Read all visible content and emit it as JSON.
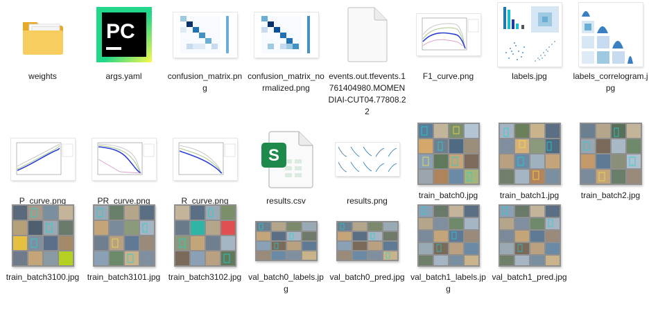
{
  "files": [
    {
      "name": "weights",
      "icon": "folder-icon"
    },
    {
      "name": "args.yaml",
      "icon": "pycharm-icon"
    },
    {
      "name": "confusion_matrix.png",
      "icon": "confusion-matrix-thumbnail"
    },
    {
      "name": "confusion_matrix_normalized.png",
      "icon": "confusion-matrix-normalized-thumbnail"
    },
    {
      "name": "events.out.tfevents.1761404980.MOMENDIAI-CUT04.77808.22",
      "icon": "blank-document-icon"
    },
    {
      "name": "F1_curve.png",
      "icon": "f1-curve-thumbnail"
    },
    {
      "name": "labels.jpg",
      "icon": "labels-thumbnail"
    },
    {
      "name": "labels_correlogram.jpg",
      "icon": "labels-correlogram-thumbnail"
    },
    {
      "name": "P_curve.png",
      "icon": "p-curve-thumbnail"
    },
    {
      "name": "PR_curve.png",
      "icon": "pr-curve-thumbnail"
    },
    {
      "name": "R_curve.png",
      "icon": "r-curve-thumbnail"
    },
    {
      "name": "results.csv",
      "icon": "spreadsheet-icon",
      "badge": "S"
    },
    {
      "name": "results.png",
      "icon": "results-thumbnail"
    },
    {
      "name": "train_batch0.jpg",
      "icon": "image-mosaic-thumbnail"
    },
    {
      "name": "train_batch1.jpg",
      "icon": "image-mosaic-thumbnail"
    },
    {
      "name": "train_batch2.jpg",
      "icon": "image-mosaic-thumbnail"
    },
    {
      "name": "train_batch3100.jpg",
      "icon": "image-mosaic-thumbnail"
    },
    {
      "name": "train_batch3101.jpg",
      "icon": "image-mosaic-thumbnail"
    },
    {
      "name": "train_batch3102.jpg",
      "icon": "image-mosaic-thumbnail"
    },
    {
      "name": "val_batch0_labels.jpg",
      "icon": "image-mosaic-thumbnail"
    },
    {
      "name": "val_batch0_pred.jpg",
      "icon": "image-mosaic-thumbnail"
    },
    {
      "name": "val_batch1_labels.jpg",
      "icon": "image-mosaic-thumbnail"
    },
    {
      "name": "val_batch1_pred.jpg",
      "icon": "image-mosaic-thumbnail"
    }
  ],
  "colors": {
    "folder": "#f6c44f",
    "pycharm_green": "#21d789",
    "pycharm_yellow": "#fcf84a",
    "spreadsheet_green": "#1d8a4c",
    "matrix_blue": "#08306b"
  }
}
